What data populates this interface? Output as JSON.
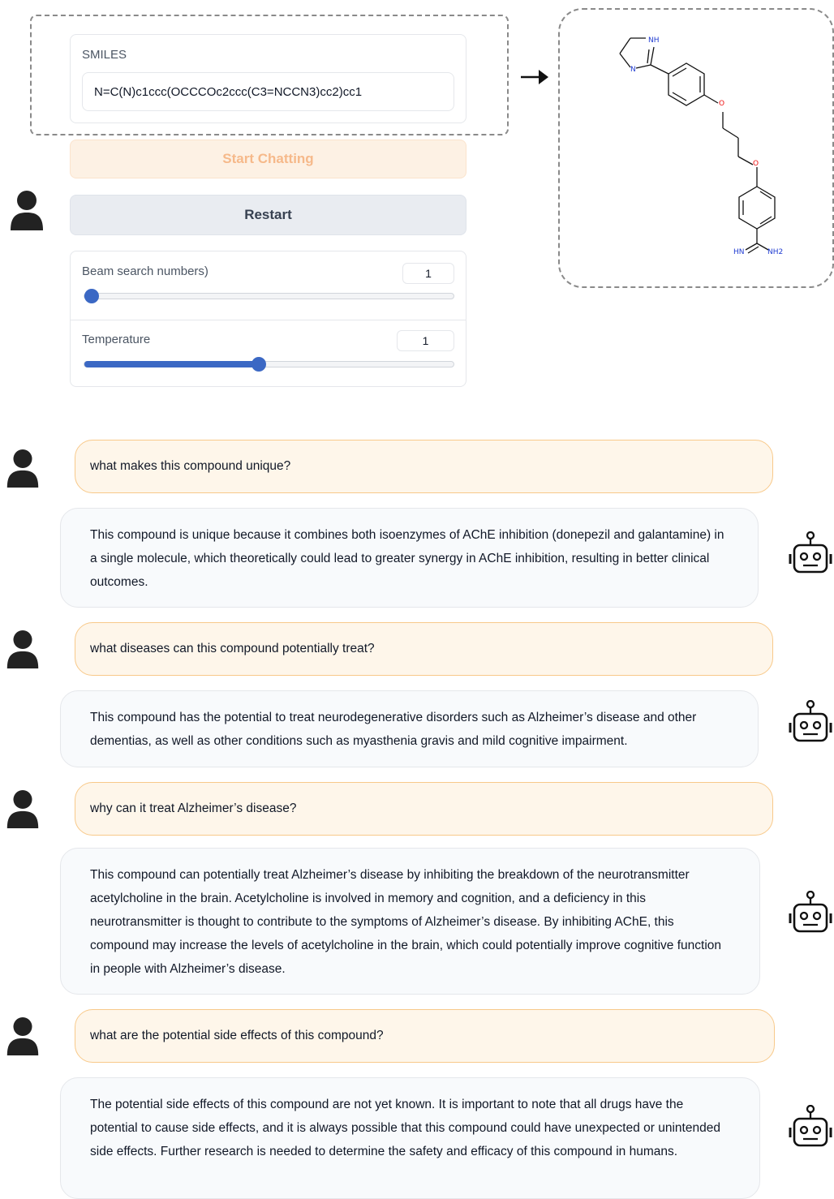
{
  "smiles": {
    "label": "SMILES",
    "value": "N=C(N)c1ccc(OCCCOc2ccc(C3=NCCN3)cc2)cc1"
  },
  "buttons": {
    "start": "Start Chatting",
    "restart": "Restart"
  },
  "params": {
    "beam": {
      "label": "Beam search numbers)",
      "value": "1",
      "slider_fraction": 0.0
    },
    "temperature": {
      "label": "Temperature",
      "value": "1",
      "slider_fraction": 0.47
    }
  },
  "molecule": {
    "atom_labels": [
      "NH",
      "N",
      "O",
      "O",
      "HN",
      "NH2"
    ]
  },
  "chat": [
    {
      "role": "user",
      "text": "what makes this compound unique?"
    },
    {
      "role": "bot",
      "text": "This compound is unique because it combines both isoenzymes of AChE inhibition (donepezil and galantamine) in a single molecule, which theoretically could lead to greater synergy in AChE inhibition, resulting in better clinical outcomes."
    },
    {
      "role": "user",
      "text": "what diseases can this compound potentially treat?"
    },
    {
      "role": "bot",
      "text": "This compound has the potential to treat neurodegenerative disorders such as Alzheimer’s disease and other dementias, as well as other conditions such as myasthenia gravis and mild cognitive impairment."
    },
    {
      "role": "user",
      "text": "why can it treat Alzheimer’s disease?"
    },
    {
      "role": "bot",
      "text": "This compound can potentially treat Alzheimer’s disease by inhibiting the breakdown of the neurotransmitter acetylcholine in the brain. Acetylcholine is involved in memory and cognition, and a deficiency in this neurotransmitter is thought to contribute to the symptoms of Alzheimer’s disease. By inhibiting AChE, this compound may increase the levels of acetylcholine in the brain, which could potentially improve cognitive function in people with Alzheimer’s disease."
    },
    {
      "role": "user",
      "text": "what are the potential side effects of this compound?"
    },
    {
      "role": "bot",
      "text": "The potential side effects of this compound are not yet known. It is important to note that all drugs have the potential to cause side effects, and it is always possible that this compound could have unexpected or unintended side effects. Further research is needed to determine the safety and efficacy of this compound in humans."
    }
  ],
  "icons": {
    "user": "person-icon",
    "bot": "robot-icon",
    "arrow": "arrow-right-icon"
  }
}
